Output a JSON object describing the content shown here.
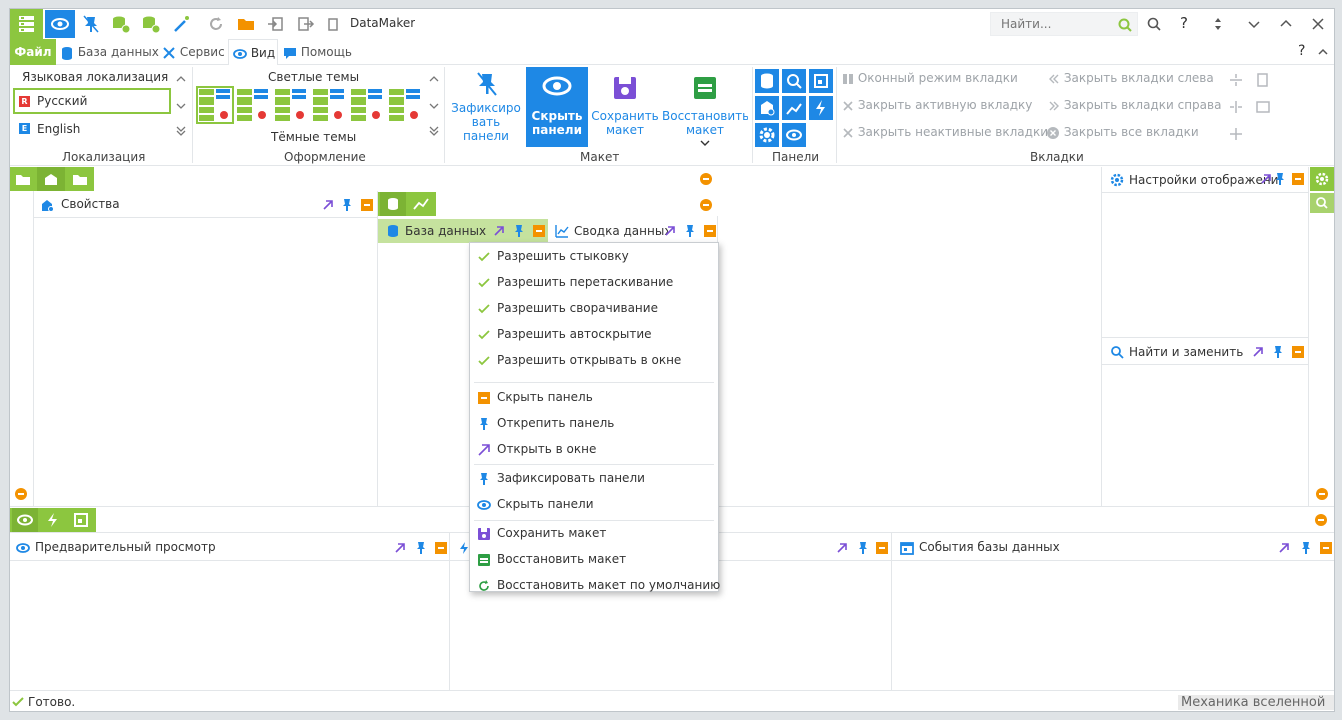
{
  "window": {
    "title": "DataMaker"
  },
  "search": {
    "placeholder": "Найти..."
  },
  "menu_tabs": {
    "file": "Файл",
    "database": "База данных",
    "service": "Сервис",
    "view": "Вид",
    "help": "Помощь"
  },
  "ribbon": {
    "localization": {
      "header": "Языковая локализация",
      "options": [
        "Русский",
        "English"
      ],
      "group": "Локализация"
    },
    "themes": {
      "light": "Светлые темы",
      "dark": "Тёмные темы",
      "group": "Оформление"
    },
    "layout": {
      "pin_line1": "Зафиксиро",
      "pin_line2": "вать",
      "pin_line3": "панели",
      "hide_line1": "Скрыть",
      "hide_line2": "панели",
      "save_line1": "Сохранить",
      "save_line2": "макет",
      "restore_line1": "Восстановить",
      "restore_line2": "макет",
      "group": "Макет"
    },
    "panels": {
      "group": "Панели"
    },
    "tabs": {
      "window_mode": "Оконный режим вкладки",
      "close_active": "Закрыть активную вкладку",
      "close_inactive": "Закрыть неактивные вкладки",
      "close_left": "Закрыть вкладки слева",
      "close_right": "Закрыть вкладки справа",
      "close_all": "Закрыть все вкладки",
      "group": "Вкладки"
    }
  },
  "panels": {
    "properties": "Свойства",
    "database": "База данных",
    "summary": "Сводка данных",
    "display_settings": "Настройки отображения",
    "find_replace": "Найти и заменить",
    "preview": "Предварительный просмотр",
    "db_events": "События базы данных"
  },
  "context_menu": {
    "allow_docking": "Разрешить стыковку",
    "allow_drag": "Разрешить перетаскивание",
    "allow_collapse": "Разрешить сворачивание",
    "allow_autohide": "Разрешить автоскрытие",
    "allow_window": "Разрешить открывать в окне",
    "hide_panel": "Скрыть панель",
    "unpin_panel": "Открепить панель",
    "open_window": "Открыть в окне",
    "pin_panels": "Зафиксировать панели",
    "hide_panels": "Скрыть панели",
    "save_layout": "Сохранить макет",
    "restore_layout": "Восстановить макет",
    "restore_default": "Восстановить макет по умолчанию"
  },
  "status": {
    "text": "Готово.",
    "right": "Механика вселенной"
  },
  "colors": {
    "accent_green": "#8cc63f",
    "accent_blue": "#1e88e5",
    "orange": "#f39200",
    "purple": "#7b4fd6"
  }
}
